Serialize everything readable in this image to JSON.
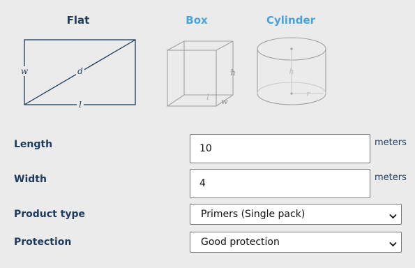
{
  "shapes": {
    "tabs": [
      {
        "label": "Flat",
        "selected": true
      },
      {
        "label": "Box",
        "selected": false
      },
      {
        "label": "Cylinder",
        "selected": false
      }
    ],
    "flat_labels": {
      "width": "w",
      "diagonal": "d",
      "length": "l"
    },
    "box_labels": {
      "height": "h",
      "length": "l",
      "width": "w"
    },
    "cylinder_labels": {
      "height": "h",
      "radius": "r"
    }
  },
  "form": {
    "length": {
      "label": "Length",
      "value": "10",
      "unit": "meters"
    },
    "width": {
      "label": "Width",
      "value": "4",
      "unit": "meters"
    },
    "product_type": {
      "label": "Product type",
      "selected": "Primers (Single pack)"
    },
    "protection": {
      "label": "Protection",
      "selected": "Good protection"
    }
  },
  "colors": {
    "navy": "#1e3a5c",
    "accent_blue": "#4aa3d8",
    "faded_gray": "#a0a0a0",
    "background": "#ebebeb"
  },
  "icons": {
    "dropdown": "chevron-down-icon"
  }
}
